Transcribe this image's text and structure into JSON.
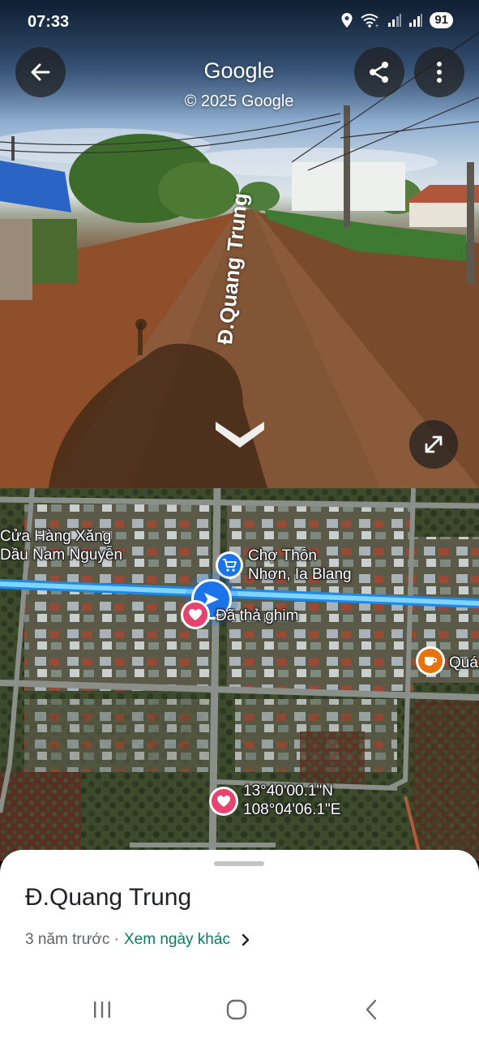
{
  "status_bar": {
    "time": "07:33",
    "battery": "91"
  },
  "street_view": {
    "title": "Google",
    "copyright": "© 2025 Google",
    "road_label": "Đ.Quang Trung",
    "icons": [
      "back-arrow-icon",
      "share-icon",
      "more-vert-icon",
      "chevron-down-icon",
      "expand-icon"
    ]
  },
  "map": {
    "labels": {
      "gas_station": "Cửa Hàng Xăng\nDầu Nam Nguyễn",
      "market": "Chợ Thôn\nNhơn, Ia Blang",
      "pinned": "Đã thả ghim",
      "cafe": "Quá",
      "coordinates": "13°40'00.1\"N\n108°04'06.1\"E"
    },
    "colors": {
      "route": "#4fc3f7",
      "heart_pin": "#e8436f",
      "market_pin": "#1a73e8",
      "cafe_pin": "#e8710a"
    }
  },
  "sheet": {
    "title": "Đ.Quang Trung",
    "meta": "3 năm trước ·",
    "link": "Xem ngày khác",
    "link_color": "#0b7a66"
  },
  "system_nav": {
    "icons": [
      "recents-icon",
      "home-icon",
      "back-icon"
    ]
  }
}
